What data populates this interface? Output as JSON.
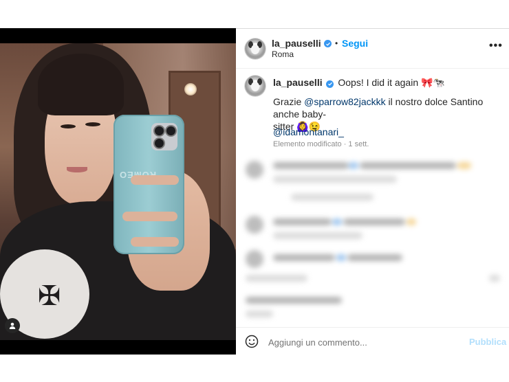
{
  "post": {
    "author": "la_pauselli",
    "separator": "•",
    "follow_label": "Segui",
    "location": "Roma",
    "more_label": "•••"
  },
  "caption": {
    "author": "la_pauselli",
    "line1": "Oops! I did it again 🎀🐄",
    "grazie": "Grazie",
    "mention1": "@sparrow82jackkk",
    "line2_rest": " il nostro dolce Santino anche baby-",
    "line3": "sitter 🙆‍♀️😉",
    "mention2": "@idamontanari_",
    "meta": "Elemento modificato · 1 sett."
  },
  "comment_bar": {
    "placeholder": "Aggiungi un commento...",
    "publish_label": "Pubblica"
  },
  "icons": {
    "verified": "verified-badge-icon",
    "tag": "user-tag-icon",
    "emoji": "emoji-icon",
    "more": "more-options-icon"
  },
  "colors": {
    "accent": "#0095f6",
    "mention": "#00376b",
    "publish_disabled": "#b2dffc",
    "verified": "#3897f0"
  }
}
